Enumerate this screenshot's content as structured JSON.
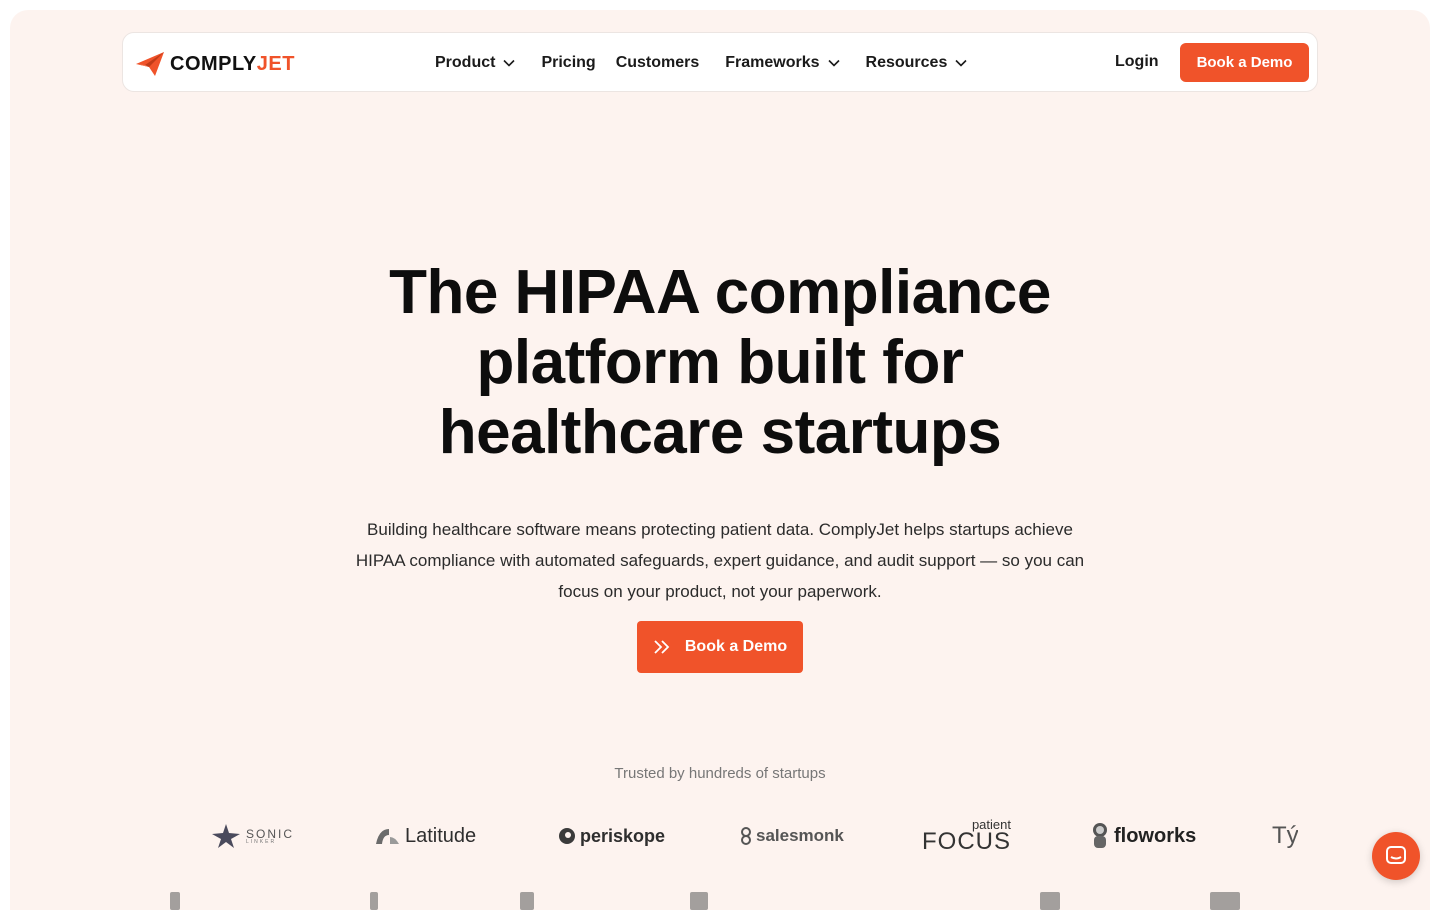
{
  "nav": {
    "logo_left": "COMPLY",
    "logo_right": "JET",
    "items": [
      {
        "label": "Product",
        "dropdown": true
      },
      {
        "label": "Pricing",
        "dropdown": false
      },
      {
        "label": "Customers",
        "dropdown": false
      },
      {
        "label": "Frameworks",
        "dropdown": true
      },
      {
        "label": "Resources",
        "dropdown": true
      }
    ],
    "login": "Login",
    "cta": "Book a Demo"
  },
  "hero": {
    "title_lines": [
      "The HIPAA compliance",
      "platform built for",
      "healthcare startups"
    ],
    "subtitle": "Building healthcare software means protecting patient data. ComplyJet helps startups achieve HIPAA compliance with automated safeguards, expert guidance, and audit support — so you can focus on your product, not your paperwork.",
    "cta": "Book a Demo"
  },
  "trusted": {
    "label": "Trusted by hundreds of startups",
    "logos": [
      {
        "name": "SONIC",
        "sub": "LINKER"
      },
      {
        "name": "Latitude"
      },
      {
        "name": "periskope"
      },
      {
        "name": "salesmonk"
      },
      {
        "name": "FOCUS",
        "sub": "patient"
      },
      {
        "name": "floworks"
      },
      {
        "name": "Tý"
      }
    ]
  },
  "colors": {
    "accent": "#f0532a",
    "background": "#fdf3ef",
    "text": "#0d0d0d"
  }
}
